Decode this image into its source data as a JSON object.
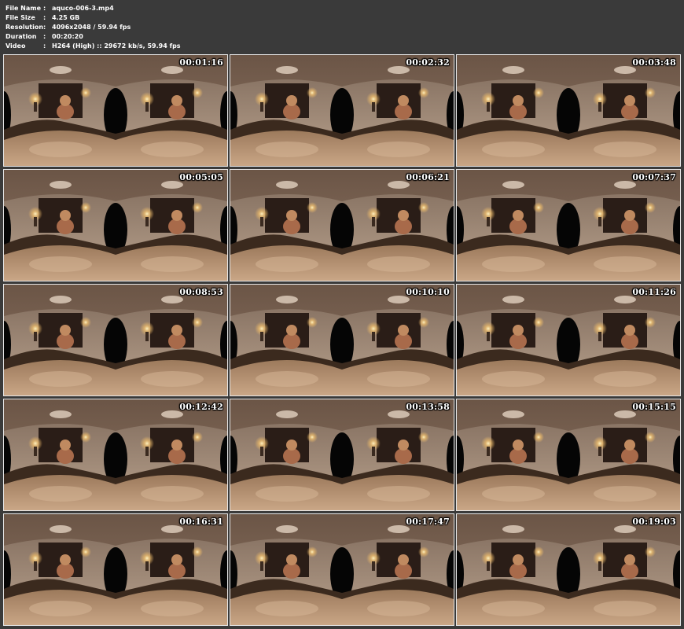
{
  "file_info": [
    {
      "key": "File Name",
      "sep": ":",
      "value": "aquco-006-3.mp4"
    },
    {
      "key": "File Size",
      "sep": ":",
      "value": "4.25 GB"
    },
    {
      "key": "Resolution",
      "sep": ":",
      "value": "4096x2048 / 59.94 fps"
    },
    {
      "key": "Duration",
      "sep": ":",
      "value": "00:20:20"
    },
    {
      "key": "Video",
      "sep": ":",
      "value": "H264 (High) :: 29672 kb/s, 59.94 fps"
    }
  ],
  "thumbnails": [
    {
      "timestamp": "00:01:16"
    },
    {
      "timestamp": "00:02:32"
    },
    {
      "timestamp": "00:03:48"
    },
    {
      "timestamp": "00:05:05"
    },
    {
      "timestamp": "00:06:21"
    },
    {
      "timestamp": "00:07:37"
    },
    {
      "timestamp": "00:08:53"
    },
    {
      "timestamp": "00:10:10"
    },
    {
      "timestamp": "00:11:26"
    },
    {
      "timestamp": "00:12:42"
    },
    {
      "timestamp": "00:13:58"
    },
    {
      "timestamp": "00:15:15"
    },
    {
      "timestamp": "00:16:31"
    },
    {
      "timestamp": "00:17:47"
    },
    {
      "timestamp": "00:19:03"
    }
  ],
  "colors": {
    "background": "#3a3a3a",
    "header_text": "#ffffff",
    "thumb_border": "#e6e6e6"
  }
}
